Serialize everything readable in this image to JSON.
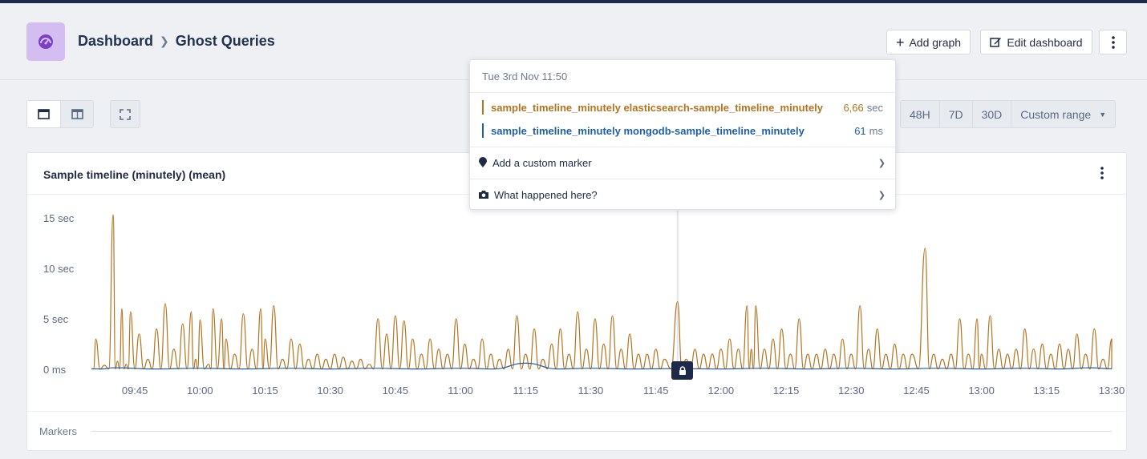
{
  "header": {
    "app_icon": "gauge-icon",
    "breadcrumb": [
      "Dashboard",
      "Ghost Queries"
    ],
    "add_graph_label": "Add graph",
    "edit_dashboard_label": "Edit dashboard",
    "more_icon": "vertical-dots-icon"
  },
  "toolbar": {
    "layout_single_icon": "single-column-icon",
    "layout_double_icon": "two-column-icon",
    "fullscreen_icon": "fullscreen-icon",
    "ranges": [
      "48H",
      "7D",
      "30D"
    ],
    "custom_range_label": "Custom range"
  },
  "panel": {
    "title": "Sample timeline (minutely) (mean)",
    "markers_label": "Markers"
  },
  "tooltip": {
    "date": "Tue 3rd Nov 11:50",
    "series": [
      {
        "name": "sample_timeline_minutely elasticsearch-sample_timeline_minutely",
        "value": "6,66",
        "unit": "sec",
        "color": "#b5731e"
      },
      {
        "name": "sample_timeline_minutely mongodb-sample_timeline_minutely",
        "value": "61",
        "unit": "ms",
        "color": "#1f5fa8"
      }
    ],
    "actions": [
      {
        "label": "Add a custom marker",
        "icon": "map-pin-icon"
      },
      {
        "label": "What happened here?",
        "icon": "camera-icon"
      }
    ]
  },
  "chart_data": {
    "type": "line",
    "title": "Sample timeline (minutely) (mean)",
    "x_ticks": [
      "09:45",
      "10:00",
      "10:15",
      "10:30",
      "10:45",
      "11:00",
      "11:15",
      "11:30",
      "11:45",
      "12:00",
      "12:15",
      "12:30",
      "12:45",
      "13:00",
      "13:15",
      "13:30"
    ],
    "y_ticks": [
      "0 ms",
      "5 sec",
      "10 sec",
      "15 sec"
    ],
    "ylim": [
      0,
      15
    ],
    "x_start": "09:35",
    "x_end": "13:30",
    "series": [
      {
        "name": "sample_timeline_minutely elasticsearch-sample_timeline_minutely",
        "color": "#b5731e",
        "peaks": [
          [
            "09:36",
            3.0
          ],
          [
            "09:38",
            0.4
          ],
          [
            "09:40",
            15.3
          ],
          [
            "09:41",
            0.8
          ],
          [
            "09:42",
            6.0
          ],
          [
            "09:43",
            0.5
          ],
          [
            "09:44",
            5.7
          ],
          [
            "09:46",
            3.5
          ],
          [
            "09:48",
            1.0
          ],
          [
            "09:50",
            4.0
          ],
          [
            "09:52",
            6.5
          ],
          [
            "09:54",
            2.0
          ],
          [
            "09:56",
            4.5
          ],
          [
            "09:58",
            5.7
          ],
          [
            "09:59",
            1.0
          ],
          [
            "10:00",
            4.9
          ],
          [
            "10:02",
            0.5
          ],
          [
            "10:03",
            6.0
          ],
          [
            "10:05",
            5.0
          ],
          [
            "10:06",
            3.0
          ],
          [
            "10:08",
            1.5
          ],
          [
            "10:10",
            5.5
          ],
          [
            "10:12",
            2.0
          ],
          [
            "10:14",
            6.0
          ],
          [
            "10:15",
            3.0
          ],
          [
            "10:17",
            6.3
          ],
          [
            "10:19",
            1.0
          ],
          [
            "10:21",
            3.0
          ],
          [
            "10:23",
            2.5
          ],
          [
            "10:25",
            1.0
          ],
          [
            "10:27",
            1.5
          ],
          [
            "10:29",
            1.0
          ],
          [
            "10:31",
            1.5
          ],
          [
            "10:33",
            1.2
          ],
          [
            "10:35",
            0.8
          ],
          [
            "10:37",
            1.0
          ],
          [
            "10:39",
            0.5
          ],
          [
            "10:41",
            5.0
          ],
          [
            "10:43",
            3.5
          ],
          [
            "10:45",
            5.3
          ],
          [
            "10:47",
            4.8
          ],
          [
            "10:49",
            3.0
          ],
          [
            "10:51",
            1.5
          ],
          [
            "10:53",
            3.0
          ],
          [
            "10:55",
            2.0
          ],
          [
            "10:57",
            1.5
          ],
          [
            "10:59",
            5.0
          ],
          [
            "11:01",
            2.5
          ],
          [
            "11:03",
            1.0
          ],
          [
            "11:05",
            3.0
          ],
          [
            "11:07",
            1.5
          ],
          [
            "11:09",
            1.0
          ],
          [
            "11:11",
            2.0
          ],
          [
            "11:13",
            5.3
          ],
          [
            "11:15",
            1.5
          ],
          [
            "11:17",
            4.0
          ],
          [
            "11:19",
            1.0
          ],
          [
            "11:21",
            2.5
          ],
          [
            "11:23",
            4.0
          ],
          [
            "11:25",
            1.5
          ],
          [
            "11:27",
            5.7
          ],
          [
            "11:29",
            2.0
          ],
          [
            "11:31",
            5.0
          ],
          [
            "11:33",
            2.5
          ],
          [
            "11:35",
            5.3
          ],
          [
            "11:37",
            2.0
          ],
          [
            "11:39",
            3.5
          ],
          [
            "11:41",
            1.5
          ],
          [
            "11:43",
            1.5
          ],
          [
            "11:45",
            2.0
          ],
          [
            "11:47",
            1.0
          ],
          [
            "11:50",
            6.7
          ],
          [
            "11:52",
            1.0
          ],
          [
            "11:54",
            2.0
          ],
          [
            "11:56",
            1.5
          ],
          [
            "11:58",
            1.5
          ],
          [
            "12:00",
            2.0
          ],
          [
            "12:02",
            3.0
          ],
          [
            "12:04",
            2.0
          ],
          [
            "12:06",
            6.3
          ],
          [
            "12:07",
            2.0
          ],
          [
            "12:08",
            6.3
          ],
          [
            "12:10",
            2.0
          ],
          [
            "12:12",
            3.0
          ],
          [
            "12:14",
            4.0
          ],
          [
            "12:16",
            1.5
          ],
          [
            "12:18",
            5.0
          ],
          [
            "12:20",
            1.5
          ],
          [
            "12:22",
            1.5
          ],
          [
            "12:24",
            2.0
          ],
          [
            "12:26",
            1.5
          ],
          [
            "12:28",
            3.0
          ],
          [
            "12:30",
            1.5
          ],
          [
            "12:32",
            6.3
          ],
          [
            "12:34",
            2.0
          ],
          [
            "12:36",
            4.0
          ],
          [
            "12:38",
            1.5
          ],
          [
            "12:40",
            2.5
          ],
          [
            "12:42",
            1.5
          ],
          [
            "12:44",
            1.5
          ],
          [
            "12:47",
            12.0
          ],
          [
            "12:49",
            1.5
          ],
          [
            "12:51",
            1.0
          ],
          [
            "12:53",
            1.5
          ],
          [
            "12:55",
            5.0
          ],
          [
            "12:57",
            1.5
          ],
          [
            "12:59",
            5.0
          ],
          [
            "13:00",
            1.5
          ],
          [
            "13:02",
            5.3
          ],
          [
            "13:04",
            2.0
          ],
          [
            "13:06",
            1.5
          ],
          [
            "13:08",
            2.0
          ],
          [
            "13:10",
            4.0
          ],
          [
            "13:12",
            2.0
          ],
          [
            "13:14",
            2.5
          ],
          [
            "13:16",
            1.5
          ],
          [
            "13:18",
            2.5
          ],
          [
            "13:20",
            2.0
          ],
          [
            "13:22",
            3.5
          ],
          [
            "13:24",
            1.5
          ],
          [
            "13:26",
            4.0
          ],
          [
            "13:28",
            1.0
          ],
          [
            "13:30",
            3.0
          ]
        ]
      },
      {
        "name": "sample_timeline_minutely mongodb-sample_timeline_minutely",
        "color": "#1f5fa8",
        "peaks": [
          [
            "09:40",
            0.15
          ],
          [
            "10:00",
            0.1
          ],
          [
            "10:20",
            0.1
          ],
          [
            "10:40",
            0.1
          ],
          [
            "11:00",
            0.1
          ],
          [
            "11:15",
            0.6
          ],
          [
            "11:30",
            0.1
          ],
          [
            "11:50",
            0.06
          ],
          [
            "12:10",
            0.1
          ],
          [
            "12:30",
            0.1
          ],
          [
            "12:50",
            0.1
          ],
          [
            "13:10",
            0.1
          ],
          [
            "13:25",
            0.15
          ]
        ]
      }
    ]
  }
}
